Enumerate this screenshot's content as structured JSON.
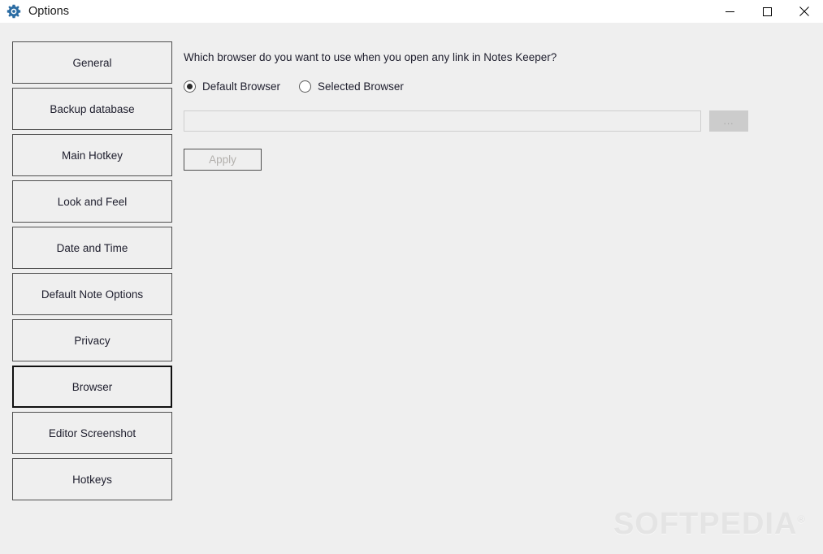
{
  "window": {
    "title": "Options",
    "icon": "gear-icon",
    "background_color": "#efefef",
    "titlebar_color": "#ffffff",
    "controls": {
      "minimize": "minimize-icon",
      "maximize": "maximize-icon",
      "close": "close-icon"
    }
  },
  "sidebar": {
    "items": [
      {
        "label": "General",
        "selected": false
      },
      {
        "label": "Backup database",
        "selected": false
      },
      {
        "label": "Main Hotkey",
        "selected": false
      },
      {
        "label": "Look and Feel",
        "selected": false
      },
      {
        "label": "Date and Time",
        "selected": false
      },
      {
        "label": "Default Note Options",
        "selected": false
      },
      {
        "label": "Privacy",
        "selected": false
      },
      {
        "label": "Browser",
        "selected": true
      },
      {
        "label": "Editor Screenshot",
        "selected": false
      },
      {
        "label": "Hotkeys",
        "selected": false
      }
    ]
  },
  "content": {
    "question": "Which browser do you want to use when you open any link in Notes Keeper?",
    "radios": [
      {
        "label": "Default Browser",
        "checked": true
      },
      {
        "label": "Selected Browser",
        "checked": false
      }
    ],
    "path_input": {
      "value": "",
      "placeholder": "",
      "disabled": true
    },
    "browse_button": {
      "label": "...",
      "disabled": true
    },
    "apply_button": {
      "label": "Apply",
      "disabled": true
    }
  },
  "watermark": {
    "text": "SOFTPEDIA",
    "mark": "®"
  }
}
